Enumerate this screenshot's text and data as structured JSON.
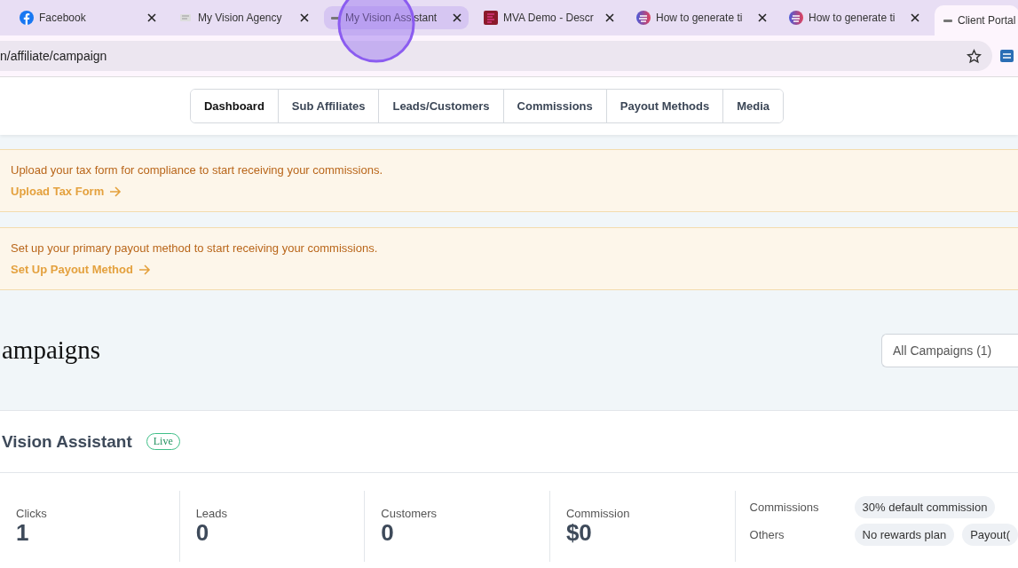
{
  "browser": {
    "tabs": [
      {
        "title": "Facebook",
        "kind": "facebook",
        "selected": false,
        "hovered": false
      },
      {
        "title": "My Vision Agency",
        "kind": "doc",
        "selected": false,
        "hovered": false
      },
      {
        "title": "My Vision Assistant",
        "kind": "small",
        "selected": false,
        "hovered": true
      },
      {
        "title": "MVA Demo - Descr",
        "kind": "mva",
        "selected": false,
        "hovered": false
      },
      {
        "title": "How to generate ti",
        "kind": "gradient",
        "selected": false,
        "hovered": false
      },
      {
        "title": "How to generate ti",
        "kind": "gradient",
        "selected": false,
        "hovered": false
      },
      {
        "title": "Client Portal",
        "kind": "small",
        "selected": true,
        "hovered": false
      }
    ],
    "url": "n/affiliate/campaign"
  },
  "nav": [
    {
      "label": "Dashboard",
      "selected": true
    },
    {
      "label": "Sub Affiliates",
      "selected": false
    },
    {
      "label": "Leads/Customers",
      "selected": false
    },
    {
      "label": "Commissions",
      "selected": false
    },
    {
      "label": "Payout Methods",
      "selected": false
    },
    {
      "label": "Media",
      "selected": false
    }
  ],
  "alerts": [
    {
      "message": "Upload your tax form for compliance to start receiving your commissions.",
      "action": "Upload Tax Form"
    },
    {
      "message": "Set up your primary payout method to start receiving your commissions.",
      "action": "Set Up Payout Method"
    }
  ],
  "campaigns": {
    "title": "ampaigns",
    "filter": "All Campaigns (1)"
  },
  "campaign": {
    "name": "Vision Assistant",
    "status": "Live",
    "stats": [
      {
        "label": "Clicks",
        "value": "1"
      },
      {
        "label": "Leads",
        "value": "0"
      },
      {
        "label": "Customers",
        "value": "0"
      },
      {
        "label": "Commission",
        "value": "$0"
      }
    ],
    "details": [
      {
        "label": "Commissions",
        "tags": [
          "30% default commission"
        ]
      },
      {
        "label": "Others",
        "tags": [
          "No rewards plan",
          "Payout("
        ]
      }
    ]
  }
}
